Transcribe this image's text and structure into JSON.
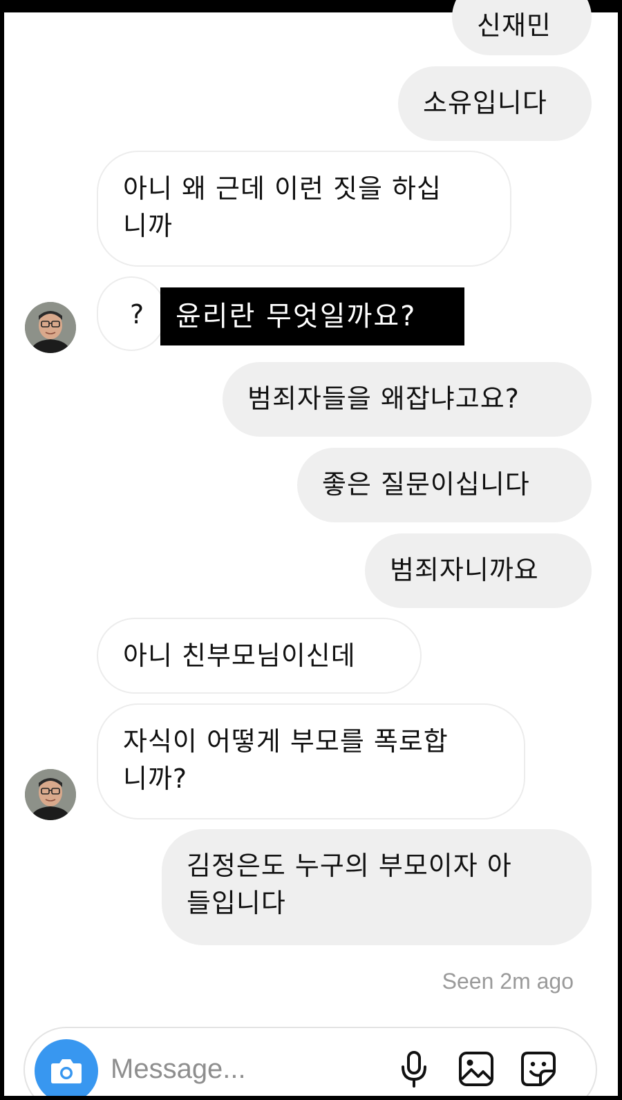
{
  "messages": [
    {
      "text": "신재민",
      "side": "outgoing"
    },
    {
      "text": "소유입니다",
      "side": "outgoing"
    },
    {
      "text": "아니 왜 근데 이런 짓을 하십\n니까",
      "side": "incoming"
    },
    {
      "text": "?",
      "side": "incoming"
    },
    {
      "text": "범죄자들을 왜잡냐고요?",
      "side": "outgoing"
    },
    {
      "text": "좋은 질문이십니다",
      "side": "outgoing"
    },
    {
      "text": "범죄자니까요",
      "side": "outgoing"
    },
    {
      "text": "아니 친부모님이신데",
      "side": "incoming"
    },
    {
      "text": "자식이 어떻게 부모를 폭로합\n니까?",
      "side": "incoming"
    },
    {
      "text": "김정은도 누구의 부모이자 아\n들입니다",
      "side": "outgoing"
    }
  ],
  "overlay_caption": "윤리란 무엇일까요?",
  "status": {
    "seen": "Seen 2m ago"
  },
  "composer": {
    "placeholder": "Message...",
    "icons": [
      "camera-icon",
      "microphone-icon",
      "gallery-icon",
      "sticker-icon"
    ],
    "accent_color": "#3897f0"
  },
  "colors": {
    "outgoing_bubble": "#efefef",
    "incoming_border": "#ececec",
    "background": "#ffffff"
  }
}
